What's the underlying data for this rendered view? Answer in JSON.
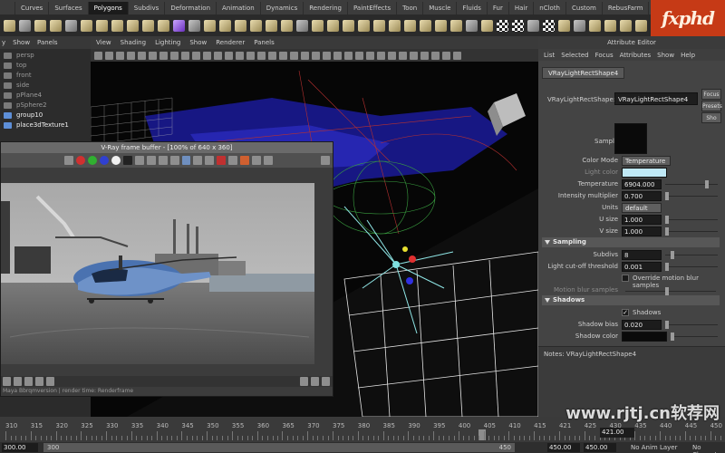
{
  "shelf": {
    "tabs": [
      "",
      "Curves",
      "Surfaces",
      "Polygons",
      "Subdivs",
      "Deformation",
      "Animation",
      "Dynamics",
      "Rendering",
      "PaintEffects",
      "Toon",
      "Muscle",
      "Fluids",
      "Fur",
      "Hair",
      "nCloth",
      "Custom",
      "RebusFarm"
    ],
    "active_tab": "Polygons"
  },
  "logo": {
    "text": "fxphd"
  },
  "outliner": {
    "menu": [
      "y",
      "Show",
      "Panels"
    ],
    "items": [
      {
        "label": "persp",
        "bright": false
      },
      {
        "label": "top",
        "bright": false
      },
      {
        "label": "front",
        "bright": false
      },
      {
        "label": "side",
        "bright": false
      },
      {
        "label": "pPlane4",
        "bright": false
      },
      {
        "label": "pSphere2",
        "bright": false
      },
      {
        "label": "group10",
        "bright": true
      },
      {
        "label": "place3dTexture1",
        "bright": true
      }
    ]
  },
  "viewport": {
    "menu": [
      "View",
      "Shading",
      "Lighting",
      "Show",
      "Renderer",
      "Panels"
    ]
  },
  "attribute_editor": {
    "title": "Attribute Editor",
    "menu": [
      "List",
      "Selected",
      "Focus",
      "Attributes",
      "Show",
      "Help"
    ],
    "tab": "VRayLightRectShape4",
    "node_label": "VRayLightRectShape:",
    "node_value": "VRayLightRectShape4",
    "focus_btn": "Focus",
    "presets_btn": "Presets",
    "show_btn": "Sho",
    "sample_label": "Sample",
    "color_mode_label": "Color Mode",
    "color_mode_value": "Temperature",
    "light_color_label": "Light color",
    "light_color_hex": "#bfe8f5",
    "temperature_label": "Temperature",
    "temperature_value": "6904.000",
    "intensity_label": "Intensity multiplier",
    "intensity_value": "0.700",
    "units_label": "Units",
    "units_value": "default",
    "usize_label": "U size",
    "usize_value": "1.000",
    "vsize_label": "V size",
    "vsize_value": "1.000",
    "sampling_header": "Sampling",
    "subdivs_label": "Subdivs",
    "subdivs_value": "8",
    "cutoff_label": "Light cut-off threshold",
    "cutoff_value": "0.001",
    "override_mb_label": "Override motion blur samples",
    "mb_samples_label": "Motion blur samples",
    "shadows_header": "Shadows",
    "shadows_check_label": "Shadows",
    "shadow_bias_label": "Shadow bias",
    "shadow_bias_value": "0.020",
    "shadow_color_label": "Shadow color",
    "notes_label": "Notes:  VRayLightRectShape4"
  },
  "frame_buffer": {
    "title": "V-Ray frame buffer - [100% of 640 x 360]",
    "status": "Maya Bbrqmversion | render time: Renderframe"
  },
  "timeline": {
    "ticks": [
      "310",
      "315",
      "320",
      "325",
      "330",
      "335",
      "340",
      "345",
      "350",
      "355",
      "360",
      "365",
      "370",
      "375",
      "380",
      "385",
      "390",
      "395",
      "400",
      "405",
      "410",
      "415",
      "421",
      "425",
      "430",
      "435",
      "440",
      "445",
      "450"
    ],
    "current_frame": "421.00",
    "range_start": "300.00",
    "range_start_inner": "300",
    "range_end_inner": "450",
    "range_end": "450.00",
    "range_end2": "450.00",
    "anim_layer": "No Anim Layer",
    "character": "No Characte"
  },
  "watermark": {
    "text": "www.rjtj.cn软荐网"
  }
}
